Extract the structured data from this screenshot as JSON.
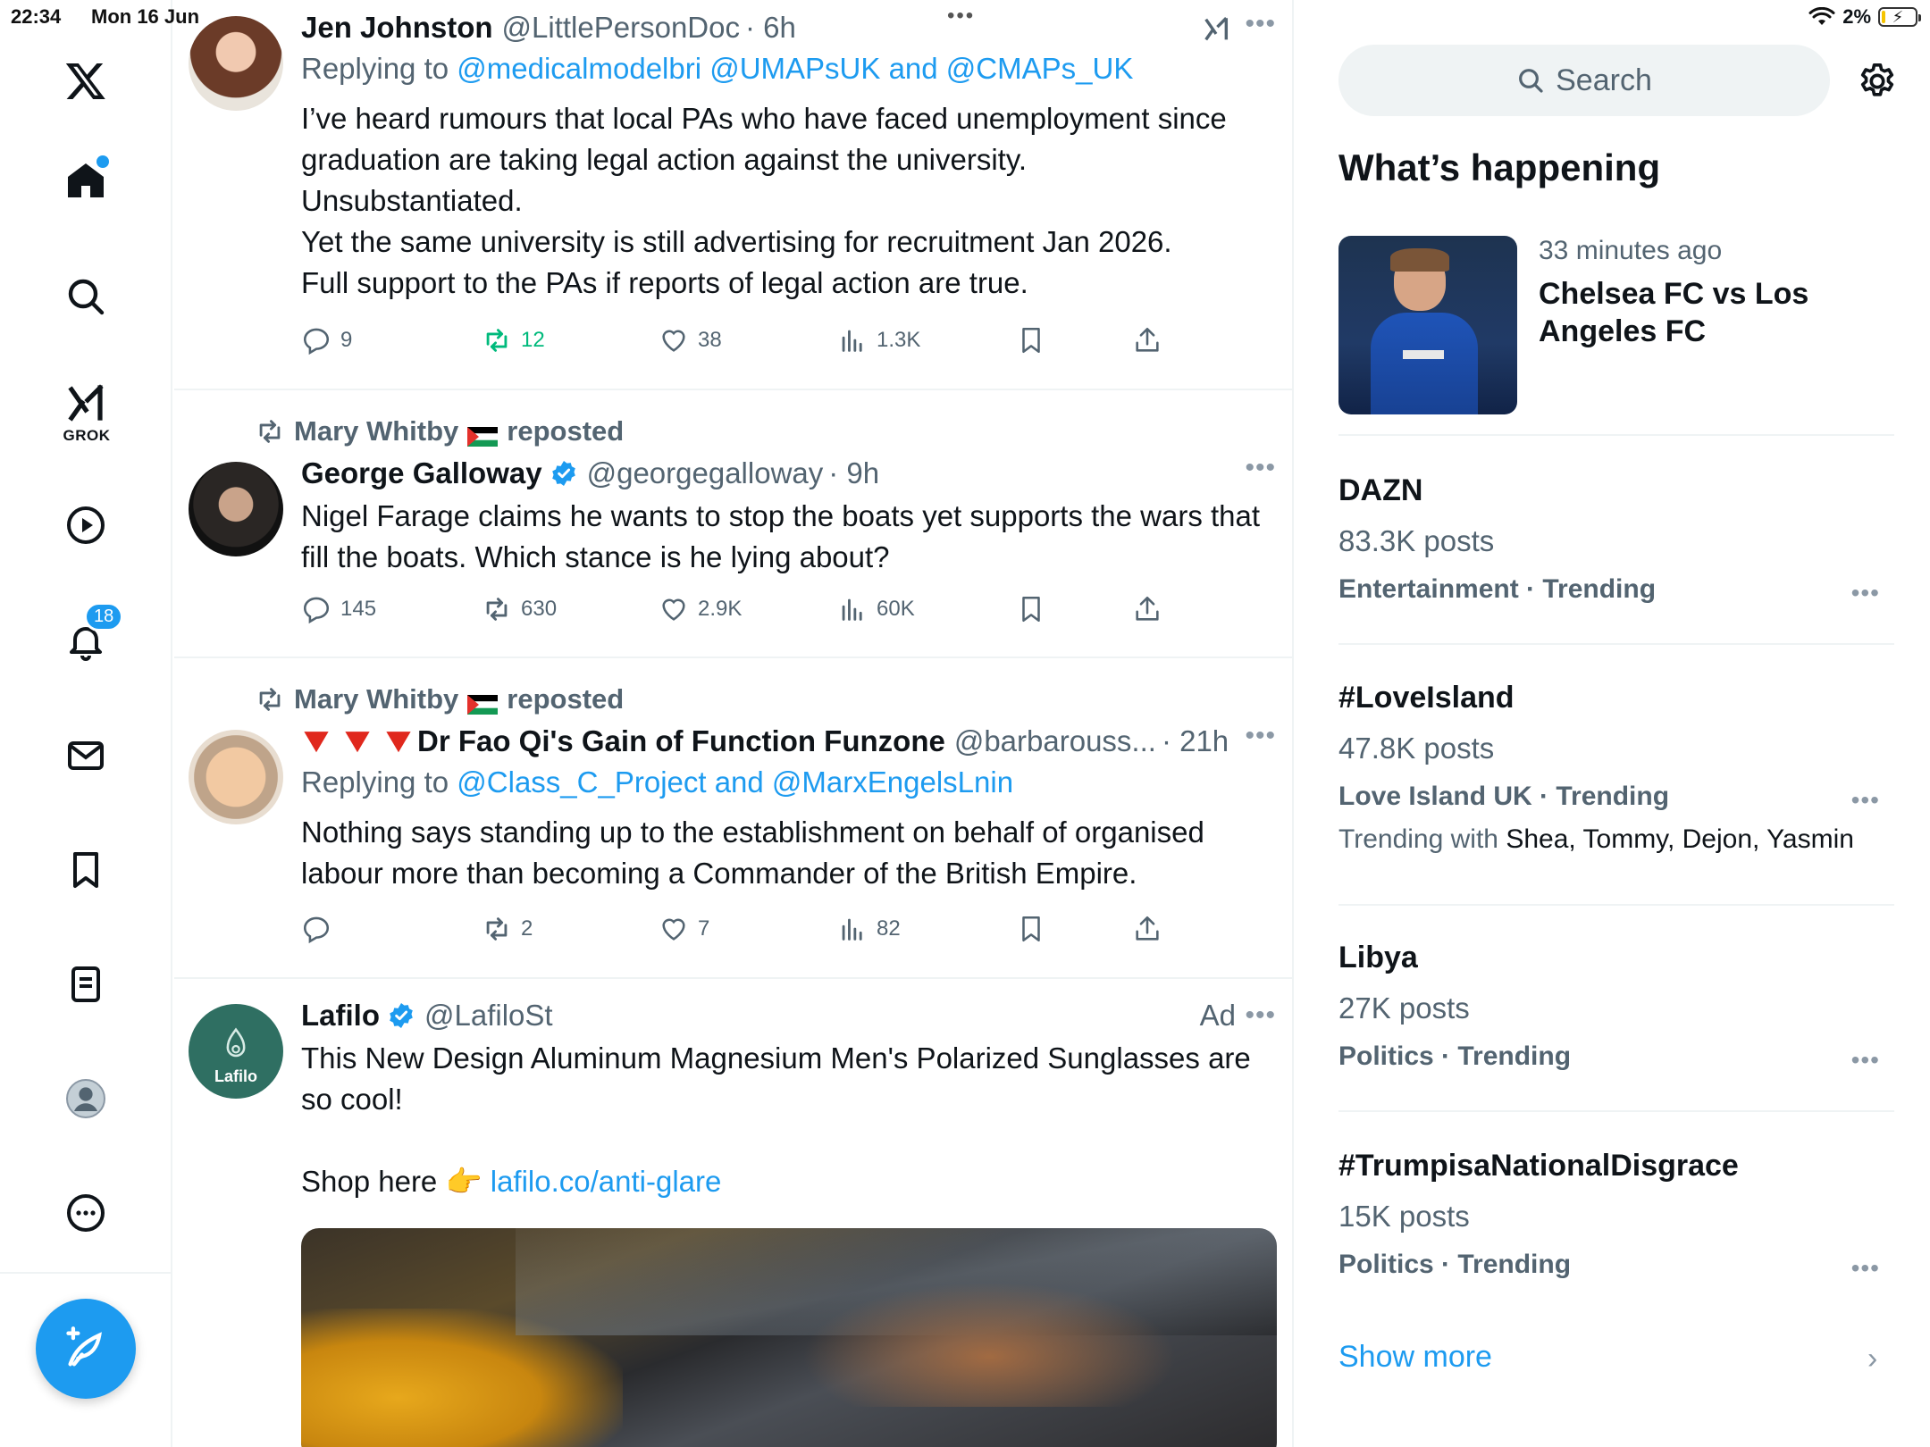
{
  "status_bar": {
    "time": "22:34",
    "date": "Mon 16 Jun",
    "battery": "2%"
  },
  "nav": {
    "notifications_badge": "18",
    "grok_label": "GROK"
  },
  "tweets": [
    {
      "name": "Jen Johnston",
      "handle": "@LittlePersonDoc",
      "time": "· 6h",
      "replying_prefix": "Replying to",
      "replying_to": "@medicalmodelbri @UMAPsUK and @CMAPs_UK",
      "text_lines": [
        "I’ve heard rumours that local PAs who have faced unemployment since graduation are taking legal action against the university.",
        "Unsubstantiated.",
        "Yet the same university is still advertising for recruitment Jan 2026.",
        "Full support to the PAs if reports of legal action are true."
      ],
      "replies": "9",
      "reposts": "12",
      "likes": "38",
      "views": "1.3K"
    },
    {
      "repost_by": "Mary Whitby",
      "repost_suffix": "reposted",
      "name": "George Galloway",
      "handle": "@georgegalloway",
      "time": "· 9h",
      "text": "Nigel Farage claims he wants to stop the boats yet supports the wars that fill the boats. Which stance is he lying about?",
      "replies": "145",
      "reposts": "630",
      "likes": "2.9K",
      "views": "60K"
    },
    {
      "repost_by": "Mary Whitby",
      "repost_suffix": "reposted",
      "name": "Dr Fao Qi's Gain of Function Funzone",
      "handle": "@barbarouss...",
      "time": "· 21h",
      "replying_prefix": "Replying to",
      "replying_to": "@Class_C_Project and @MarxEngelsLnin",
      "text": "Nothing says standing up to the establishment on behalf of organised labour more than becoming a Commander of the British Empire.",
      "replies": "",
      "reposts": "2",
      "likes": "7",
      "views": "82"
    },
    {
      "name": "Lafilo",
      "handle": "@LafiloSt",
      "ad_label": "Ad",
      "avatar_text": "Lafilo",
      "text": "This New Design Aluminum Magnesium Men's Polarized Sunglasses are so cool!",
      "shop_text": "Shop here",
      "shop_link": "lafilo.co/anti-glare"
    }
  ],
  "sidebar": {
    "search_placeholder": "Search",
    "section_title": "What’s happening",
    "news": {
      "time": "33 minutes ago",
      "title": "Chelsea FC vs Los Angeles FC"
    },
    "trends": [
      {
        "name": "DAZN",
        "posts": "83.3K posts",
        "category": "Entertainment · Trending"
      },
      {
        "name": "#LoveIsland",
        "posts": "47.8K posts",
        "category": "Love Island UK · Trending",
        "with_prefix": "Trending with",
        "with_names": "Shea, Tommy, Dejon, Yasmin"
      },
      {
        "name": "Libya",
        "posts": "27K posts",
        "category": "Politics · Trending"
      },
      {
        "name": "#TrumpisaNationalDisgrace",
        "posts": "15K posts",
        "category": "Politics · Trending"
      }
    ],
    "show_more": "Show more"
  },
  "colors": {
    "accent": "#1d9bf0",
    "repost_green": "#00ba7c",
    "secondary_text": "#536471"
  }
}
